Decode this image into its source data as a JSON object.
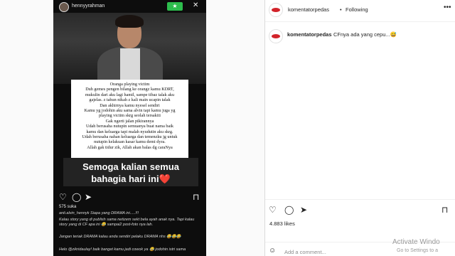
{
  "story": {
    "username": "hennyyrahman",
    "green_label": "★",
    "close_icon": "x-icon",
    "note_lines": [
      "Oranga playing victim",
      "Duh gemes pengen bilang ke orangz kamu KDRT,",
      "mukulin dari aku lagi hamil, sampe tibaz talak aku",
      "gajelas. z tahun nikah z kali main ucapin talak",
      "Dan akhirnya kamu nyesel sendiri",
      "Kamu yg jodohin aku sama alvin tapi kamu juga yg",
      "playing victim skrg seolah tersakiti",
      "Gak ngerti jalan pikirannya",
      "Udah berusaha nutupin semuanya buat nama baik",
      "kamu dan keluarga tapi malah nyudutin aku skrg.",
      "Udah berusaha nahan keluarga dan temenzku jg untuk",
      "nutupin kelakuan kasar kamu demi dyra.",
      "Allah gak tidur zik, Allah akan balas dg caraNya"
    ],
    "caption_line1": "Semoga kalian semua",
    "caption_line2": "bahagia hari ini❤️",
    "likes": "575 suka",
    "comments": [
      "anti.alvin_hennyk Siapa yang DRAMA ini.....!!!",
      "Kalau story yang di publish sama netizem sekt bela ayah anak nya. Tapi kalau story yang di CF apa ini 😂 sampai2 post-foto nya lah.",
      "Jangan teriak DRAMA kalau anda sendiri pelaku DRAMA nhs 😂😂😂",
      "Helo @zikridaulay! baik banget kamu jadi cowok ya 😂 jodohin istri sama"
    ],
    "colors": {
      "background": "#0d0d0d",
      "green": "#2dbd4d"
    }
  },
  "post": {
    "header_username": "komentatorpedas",
    "separator": "•",
    "follow_status": "Following",
    "comment_username": "komentatorpedas",
    "comment_text": "CFnya ada yang cepu...😅",
    "likes_count": "4.883 likes",
    "add_comment_placeholder": "Add a comment...",
    "icons": [
      "heart-icon",
      "comment-icon",
      "share-icon",
      "bookmark-icon",
      "smile-icon",
      "more-icon"
    ]
  },
  "watermark": {
    "line1": "Activate Windo",
    "line2": "Go to Settings to a"
  }
}
